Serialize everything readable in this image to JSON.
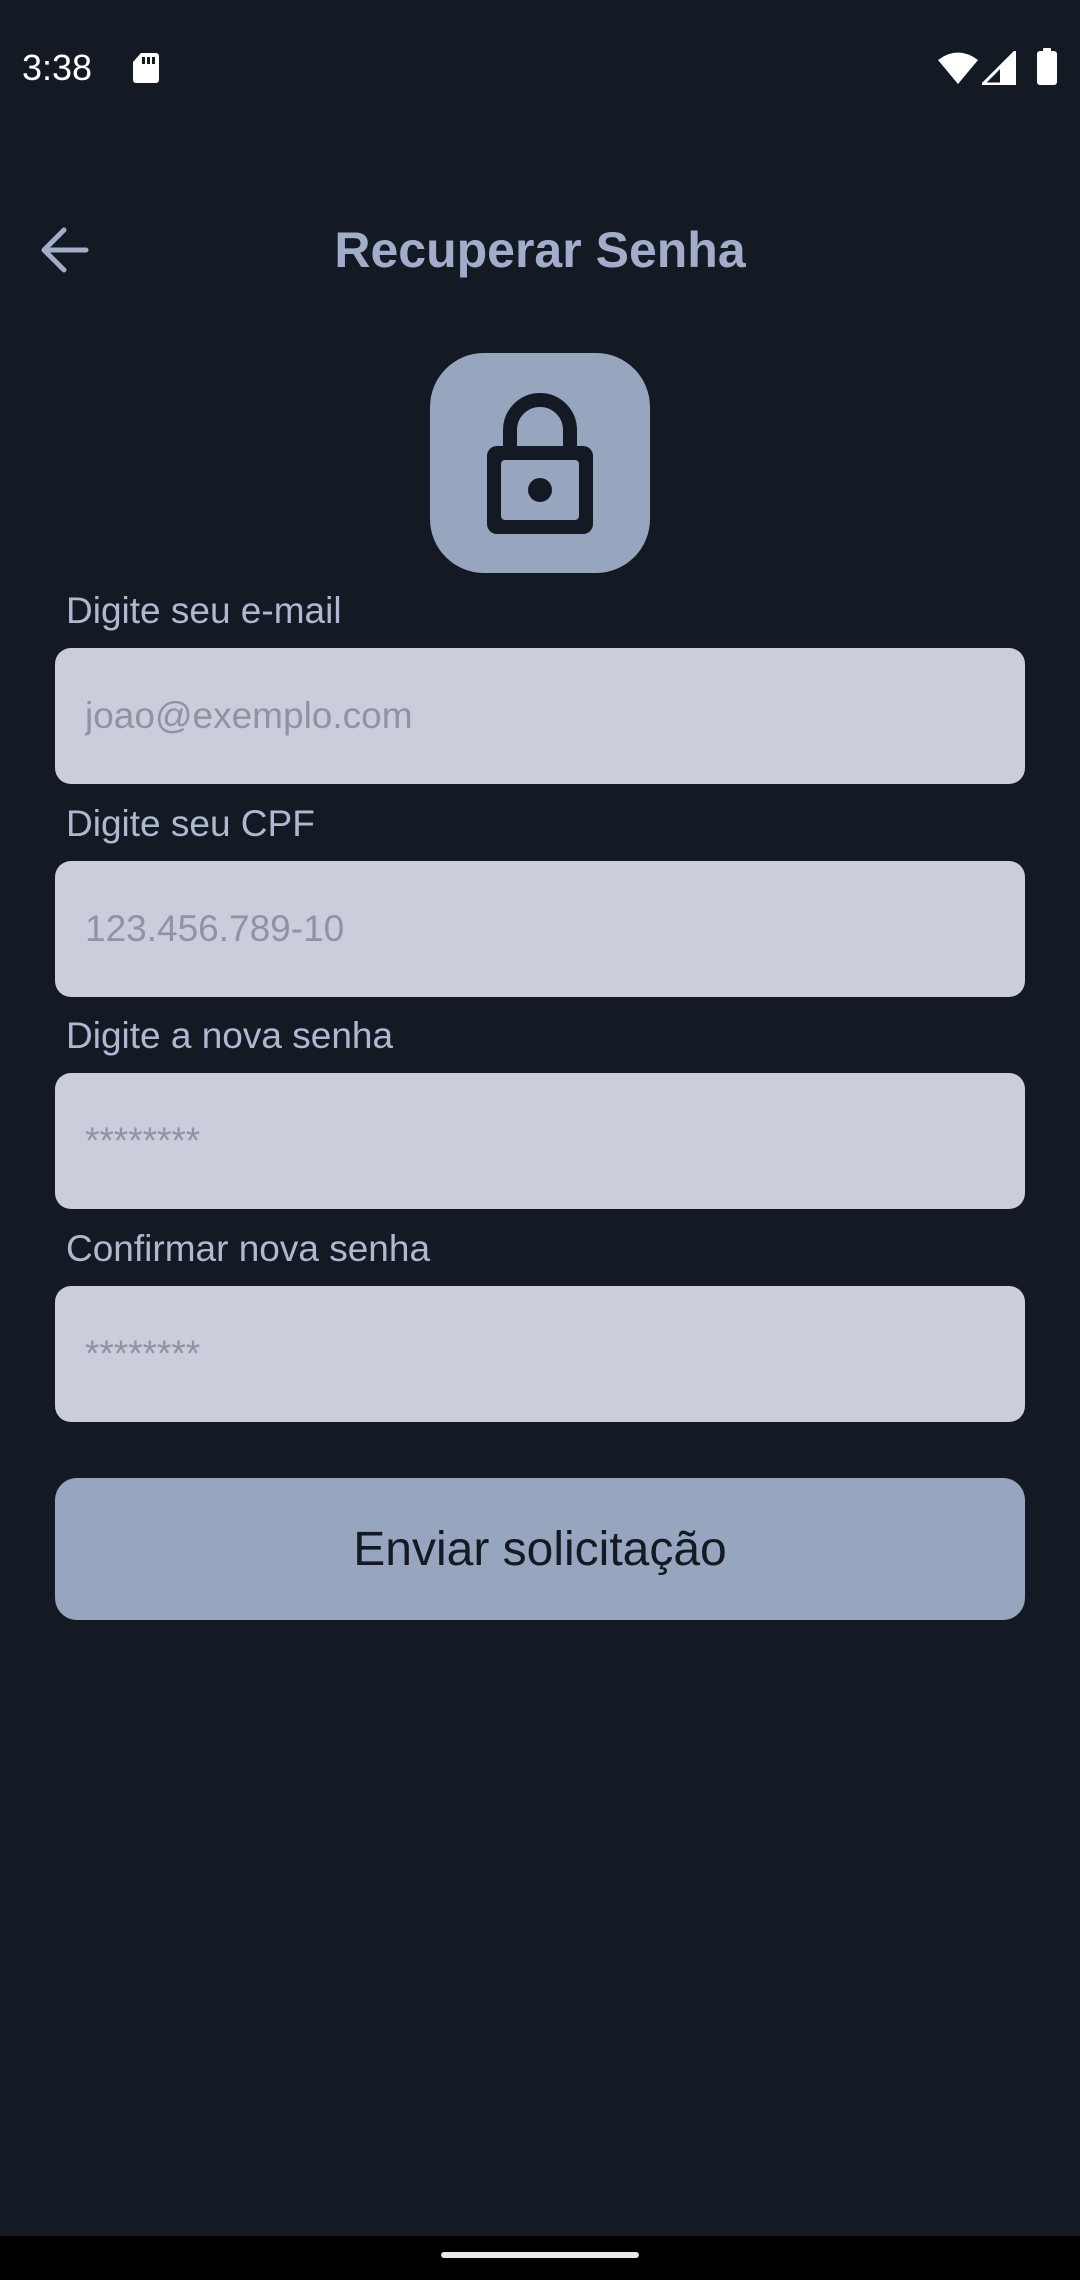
{
  "status_bar": {
    "time": "3:38",
    "icons": [
      "sd-card-icon",
      "wifi-icon",
      "cell-signal-icon",
      "battery-icon"
    ]
  },
  "app_bar": {
    "back_icon": "arrow-back-icon",
    "title": "Recuperar Senha"
  },
  "header_icon": "lock-icon",
  "form": {
    "email": {
      "label": "Digite seu e-mail",
      "placeholder": "joao@exemplo.com",
      "value": ""
    },
    "cpf": {
      "label": "Digite seu CPF",
      "placeholder": "123.456.789-10",
      "value": ""
    },
    "new_password": {
      "label": "Digite a nova senha",
      "placeholder": "********",
      "value": ""
    },
    "confirm_password": {
      "label": "Confirmar nova senha",
      "placeholder": "********",
      "value": ""
    },
    "submit_label": "Enviar solicitação"
  },
  "colors": {
    "background": "#141a24",
    "accent": "#98a5bf",
    "input_background": "#cbcdda",
    "title": "#a2adc9"
  }
}
